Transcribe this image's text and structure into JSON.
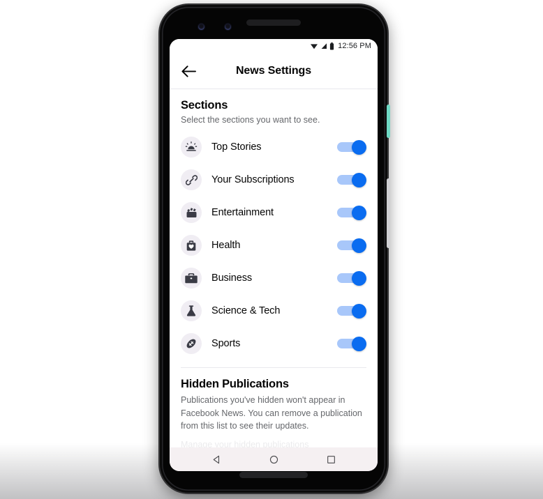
{
  "device": {
    "name": "android-phone",
    "power_button_color": "#6fd9c4",
    "volume_button_color": "#cfcfd2"
  },
  "statusbar": {
    "time": "12:56 PM",
    "icons": [
      "wifi-icon",
      "cellular-signal-icon",
      "battery-icon"
    ]
  },
  "appbar": {
    "back_icon": "back-arrow-icon",
    "title": "News Settings"
  },
  "sections": {
    "title": "Sections",
    "subtitle": "Select the sections you want to see.",
    "items": [
      {
        "label": "Top Stories",
        "icon": "sunrise-icon",
        "enabled": true
      },
      {
        "label": "Your Subscriptions",
        "icon": "link-icon",
        "enabled": true
      },
      {
        "label": "Entertainment",
        "icon": "clapperboard-icon",
        "enabled": true
      },
      {
        "label": "Health",
        "icon": "medical-bag-icon",
        "enabled": true
      },
      {
        "label": "Business",
        "icon": "briefcase-icon",
        "enabled": true
      },
      {
        "label": "Science & Tech",
        "icon": "flask-icon",
        "enabled": true
      },
      {
        "label": "Sports",
        "icon": "football-icon",
        "enabled": true
      }
    ]
  },
  "hidden_publications": {
    "title": "Hidden Publications",
    "description": "Publications you've hidden won't appear in Facebook News. You can remove a publication from this list to see their updates.",
    "cutoff_text": "Manage your hidden publications"
  },
  "navbar": {
    "back_label": "back-nav-icon",
    "home_label": "home-nav-icon",
    "recents_label": "recents-nav-icon"
  },
  "colors": {
    "toggle_on_thumb": "#0a6cf0",
    "toggle_on_track": "#a8c7fa",
    "icon_bubble": "#f0edf3",
    "text_primary": "#050505",
    "text_secondary": "#65676b"
  }
}
